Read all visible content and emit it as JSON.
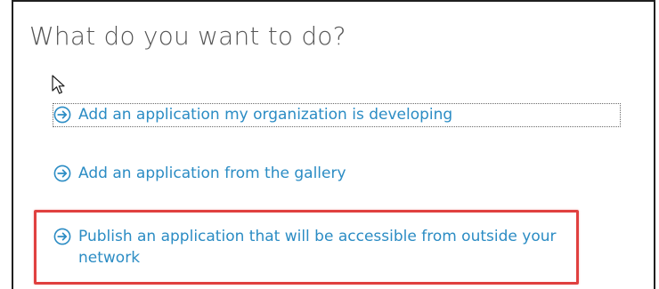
{
  "dialog": {
    "title": "What do you want to do?"
  },
  "options": [
    {
      "label": "Add an application my organization is developing",
      "icon": "arrow-circle-right-icon",
      "focused": true
    },
    {
      "label": "Add an application from the gallery",
      "icon": "arrow-circle-right-icon"
    },
    {
      "label": "Publish an application that will be accessible from outside your network",
      "icon": "arrow-circle-right-icon",
      "highlighted": true
    }
  ],
  "colors": {
    "link": "#2b8cc4",
    "title": "#555555",
    "highlight_border": "#e0403f",
    "frame": "#1f1f1f"
  }
}
